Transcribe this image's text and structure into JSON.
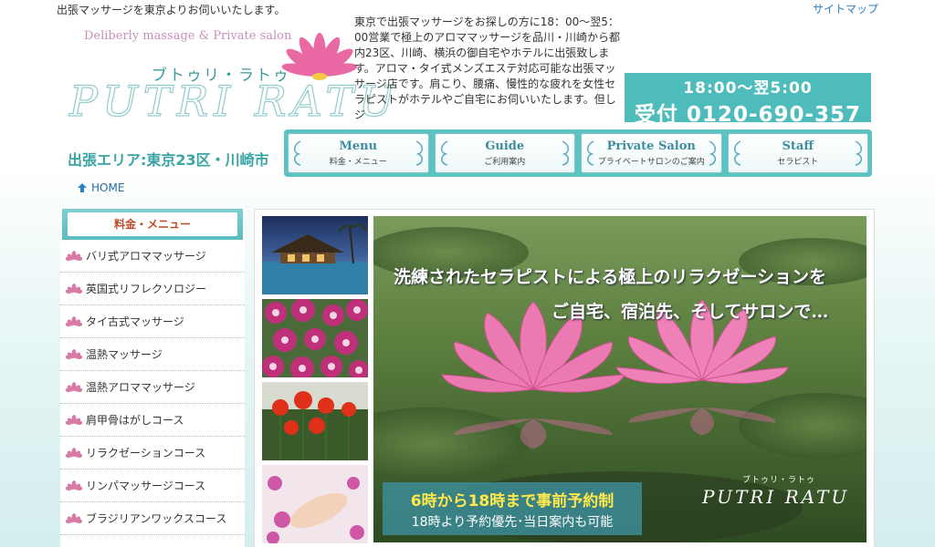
{
  "header": {
    "tagline": "出張マッサージを東京よりお伺いいたします。",
    "sitemap": "サイトマップ",
    "logo_sub": "Deliberly massage & Private salon",
    "logo_kana": "ブトゥリ・ラトゥ",
    "logo_main": "PUTRI RATU",
    "intro": "東京で出張マッサージをお探しの方に18：00〜翌5：00営業で極上のアロママッサージを品川・川崎から都内23区、川崎、横浜の御自宅やホテルに出張致します。アロマ・タイ式メンズエステ対応可能な出張マッサージ店です。肩こり、腰痛、慢性的な疲れを女性セラピストがホテルやご自宅にお伺いいたします。但しジ",
    "phone_hours": "18:00〜翌5:00",
    "phone_number": "受付 0120-690-357",
    "area": "出張エリア:東京23区・川崎市"
  },
  "nav": [
    {
      "en": "Menu",
      "jp": "料金・メニュー"
    },
    {
      "en": "Guide",
      "jp": "ご利用案内"
    },
    {
      "en": "Private Salon",
      "jp": "プライベートサロンのご案内"
    },
    {
      "en": "Staff",
      "jp": "セラピスト"
    }
  ],
  "breadcrumb": {
    "home": "HOME"
  },
  "sidebar": {
    "heading": "料金・メニュー",
    "items": [
      {
        "label": "バリ式アロママッサージ"
      },
      {
        "label": "英国式リフレクソロジー"
      },
      {
        "label": "タイ古式マッサージ"
      },
      {
        "label": "温熱マッサージ"
      },
      {
        "label": "温熱アロママッサージ"
      },
      {
        "label": "肩甲骨はがしコース"
      },
      {
        "label": "リラクゼーションコース"
      },
      {
        "label": "リンパマッサージコース"
      },
      {
        "label": "ブラジリアンワックスコース"
      }
    ]
  },
  "hero": {
    "line1": "洗練されたセラピストによる極上のリラクゼーションを",
    "line2": "ご自宅、宿泊先、そしてサロンで…",
    "banner_line1": "6時から18時まで事前予約制",
    "banner_line2": "18時より予約優先･当日案内も可能",
    "logo_kana": "ブトゥリ・ラトゥ",
    "logo_main": "PUTRI RATU"
  },
  "colors": {
    "accent": "#4fbcbc",
    "link": "#2a7fc6",
    "sidebar_heading": "#c04a2a",
    "banner_highlight": "#ffe94a"
  }
}
